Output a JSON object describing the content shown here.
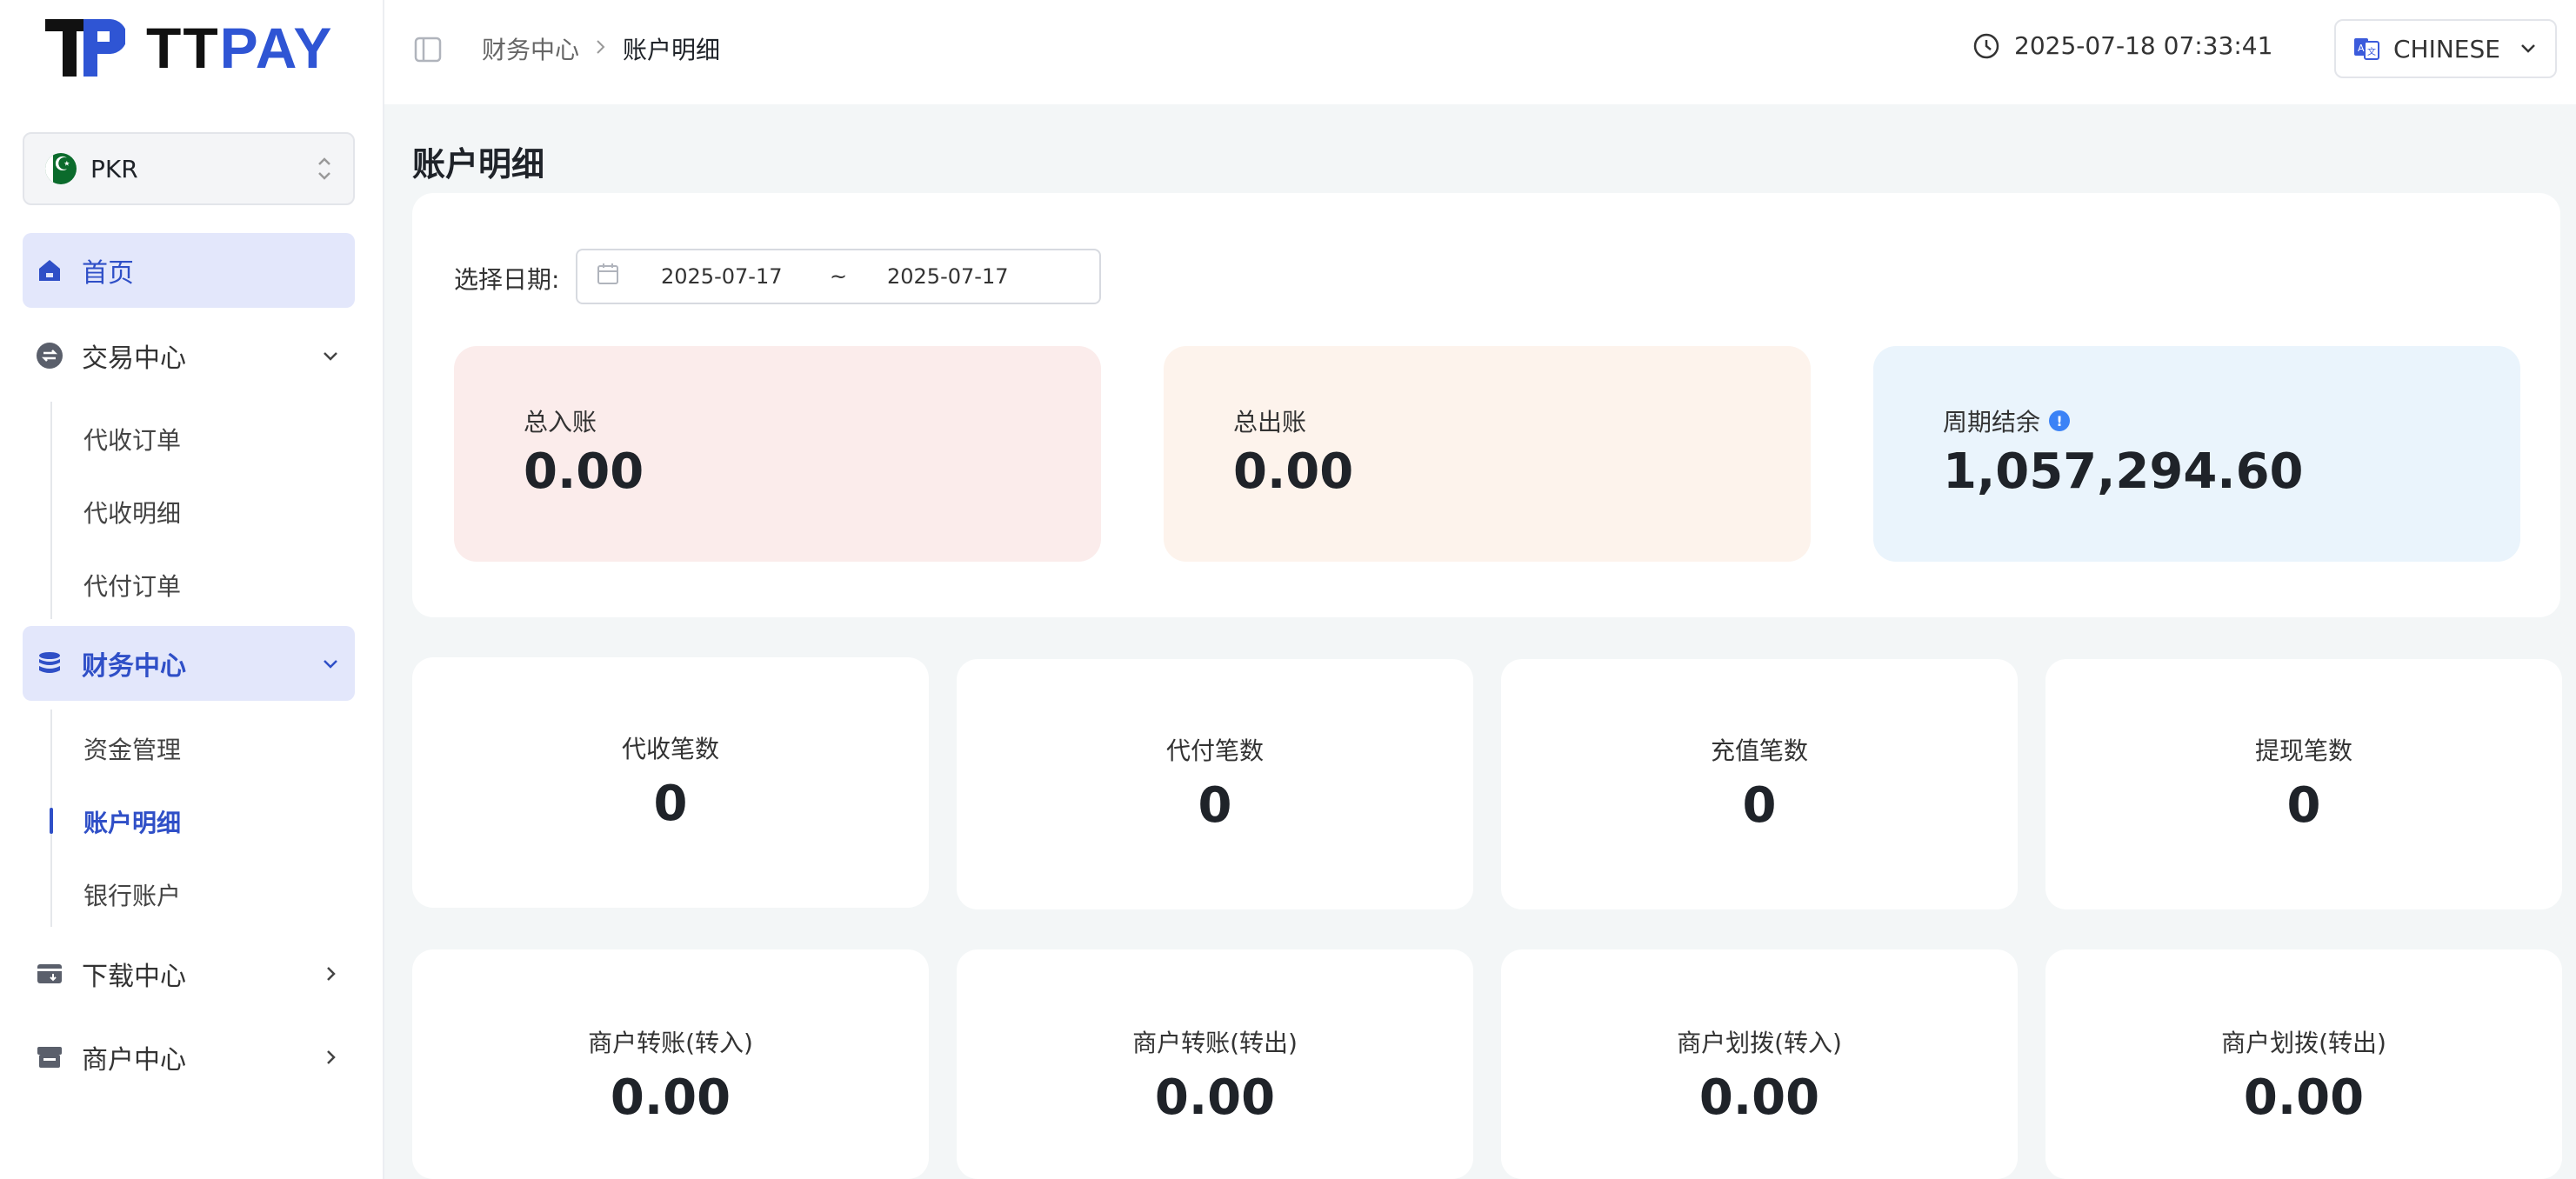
{
  "brand": {
    "logo_tt": "TT",
    "logo_pay": "PAY"
  },
  "currency": {
    "code": "PKR"
  },
  "sidebar": {
    "items": [
      {
        "label": "首页"
      },
      {
        "label": "交易中心",
        "children": [
          "代收订单",
          "代收明细",
          "代付订单"
        ]
      },
      {
        "label": "财务中心",
        "children": [
          "资金管理",
          "账户明细",
          "银行账户"
        ]
      },
      {
        "label": "下载中心"
      },
      {
        "label": "商户中心"
      }
    ]
  },
  "header": {
    "breadcrumb": [
      "财务中心",
      "账户明细"
    ],
    "datetime": "2025-07-18 07:33:41",
    "language": "CHINESE"
  },
  "page": {
    "title": "账户明细",
    "date_label": "选择日期:",
    "date_start": "2025-07-17",
    "date_sep": "~",
    "date_end": "2025-07-17"
  },
  "summary": [
    {
      "label": "总入账",
      "value": "0.00",
      "bg": "#fbeceb"
    },
    {
      "label": "总出账",
      "value": "0.00",
      "bg": "#fdf3ec"
    },
    {
      "label": "周期结余",
      "value": "1,057,294.60",
      "bg": "#eaf4fc"
    }
  ],
  "stats_counts": [
    {
      "label": "代收笔数",
      "value": "0"
    },
    {
      "label": "代付笔数",
      "value": "0"
    },
    {
      "label": "充值笔数",
      "value": "0"
    },
    {
      "label": "提现笔数",
      "value": "0"
    }
  ],
  "stats_amounts": [
    {
      "label": "商户转账(转入)",
      "value": "0.00"
    },
    {
      "label": "商户转账(转出)",
      "value": "0.00"
    },
    {
      "label": "商户划拨(转入)",
      "value": "0.00"
    },
    {
      "label": "商户划拨(转出)",
      "value": "0.00"
    }
  ],
  "colors": {
    "accent": "#2f4fc7",
    "active_bg": "#e3e7fb",
    "info": "#3b82f6"
  }
}
